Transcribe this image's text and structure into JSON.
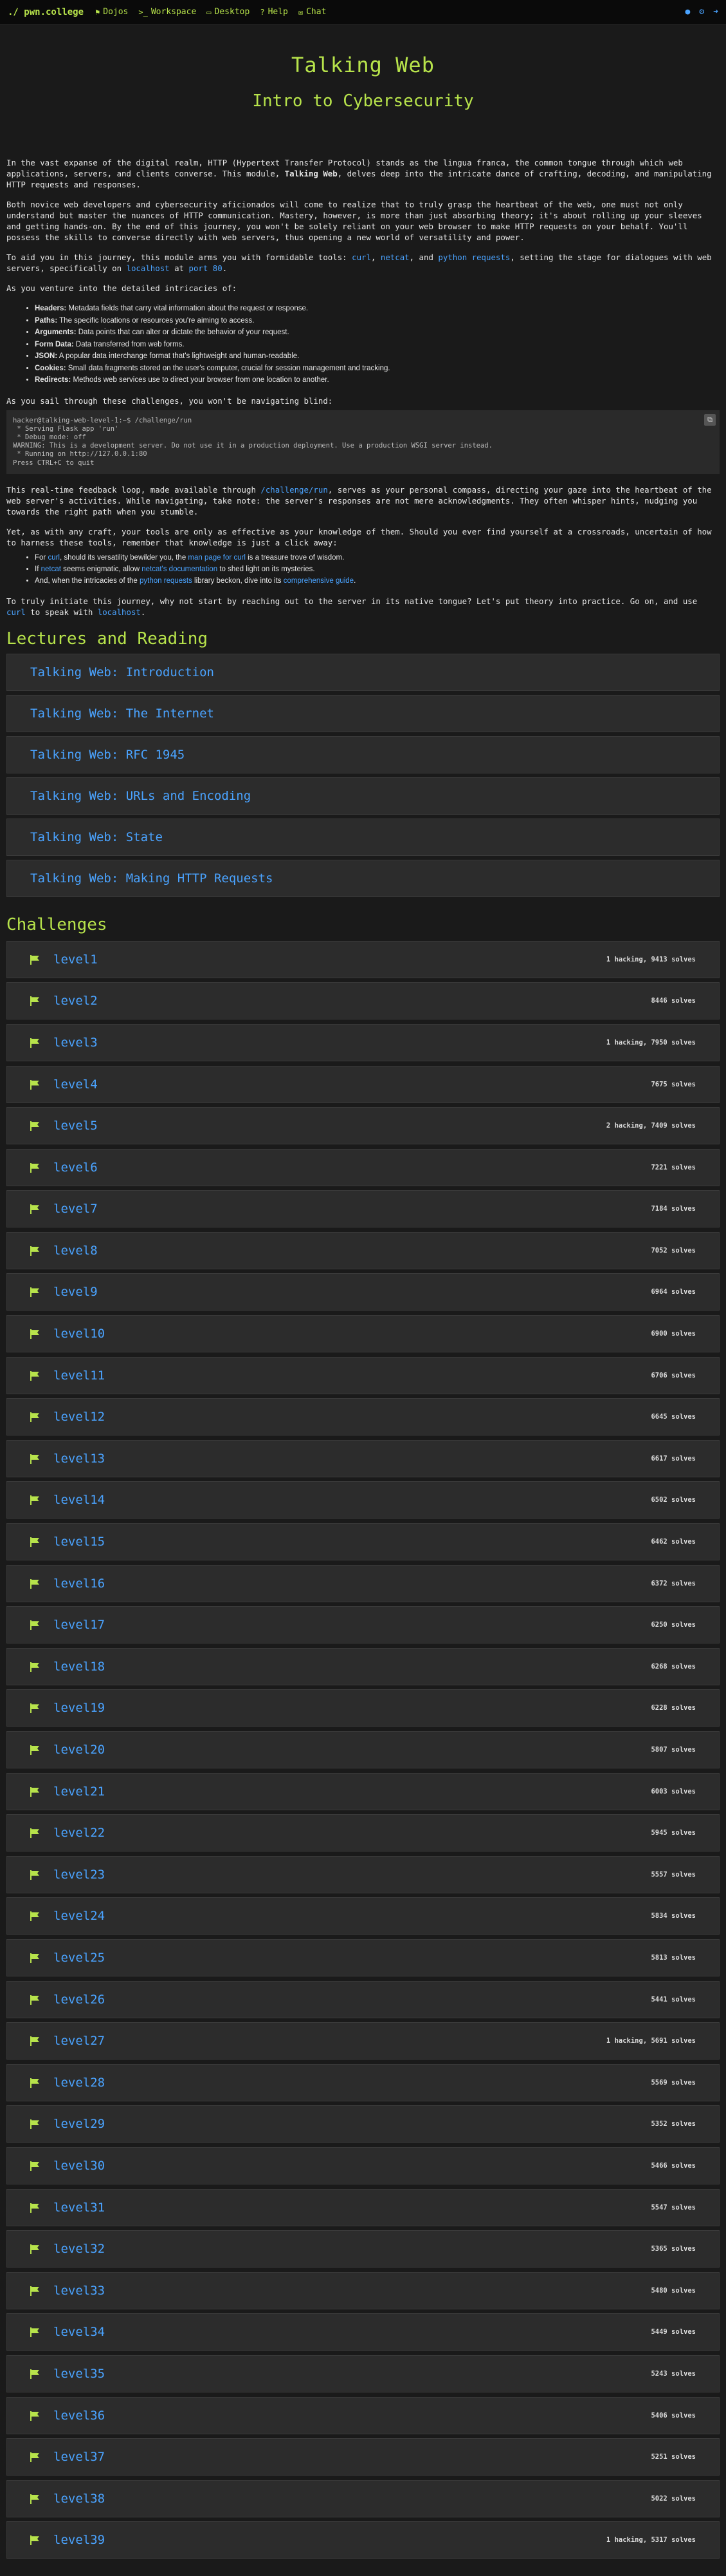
{
  "nav": {
    "brand": "./ pwn.college",
    "items": [
      {
        "label": "Dojos",
        "icon": "flag-icon"
      },
      {
        "label": "Workspace",
        "icon": "terminal-icon"
      },
      {
        "label": "Desktop",
        "icon": "desktop-icon"
      },
      {
        "label": "Help",
        "icon": "question-icon"
      },
      {
        "label": "Chat",
        "icon": "chat-icon"
      }
    ],
    "right_icons": [
      "user-circle-icon",
      "settings-icon",
      "logout-icon"
    ]
  },
  "hero": {
    "title": "Talking Web",
    "subtitle": "Intro to Cybersecurity"
  },
  "desc": {
    "p1": "In the vast expanse of the digital realm, HTTP (Hypertext Transfer Protocol) stands as the lingua franca, the common tongue through which web applications, servers, and clients converse. This module, ",
    "p1_bold": "Talking Web",
    "p1_end": ", delves deep into the intricate dance of crafting, decoding, and manipulating HTTP requests and responses.",
    "p2": "Both novice web developers and cybersecurity aficionados will come to realize that to truly grasp the heartbeat of the web, one must not only understand but master the nuances of HTTP communication. Mastery, however, is more than just absorbing theory; it's about rolling up your sleeves and getting hands-on. By the end of this journey, you won't be solely reliant on your web browser to make HTTP requests on your behalf. You'll possess the skills to converse directly with web servers, thus opening a new world of versatility and power.",
    "p3_a": "To aid you in this journey, this module arms you with formidable tools: ",
    "p3_curl": "curl",
    "p3_b": ", ",
    "p3_netcat": "netcat",
    "p3_c": ", and ",
    "p3_requests": "python requests",
    "p3_d": ", setting the stage for dialogues with web servers, specifically on ",
    "p3_localhost": "localhost",
    "p3_e": " at ",
    "p3_port": "port 80",
    "p3_f": ".",
    "p4": "As you venture into the detailed intricacies of:",
    "terms": [
      {
        "term": "Headers:",
        "def": " Metadata fields that carry vital information about the request or response."
      },
      {
        "term": "Paths:",
        "def": " The specific locations or resources you're aiming to access."
      },
      {
        "term": "Arguments:",
        "def": " Data points that can alter or dictate the behavior of your request."
      },
      {
        "term": "Form Data:",
        "def": " Data transferred from web forms."
      },
      {
        "term": "JSON:",
        "def": " A popular data interchange format that's lightweight and human-readable."
      },
      {
        "term": "Cookies:",
        "def": " Small data fragments stored on the user's computer, crucial for session management and tracking."
      },
      {
        "term": "Redirects:",
        "def": " Methods web services use to direct your browser from one location to another."
      }
    ],
    "p5": "As you sail through these challenges, you won't be navigating blind:",
    "code": "hacker@talking-web-level-1:~$ /challenge/run\n * Serving Flask app 'run'\n * Debug mode: off\nWARNING: This is a development server. Do not use it in a production deployment. Use a production WSGI server instead.\n * Running on http://127.0.0.1:80\nPress CTRL+C to quit",
    "p6_a": "This real-time feedback loop, made available through ",
    "p6_link": "/challenge/run",
    "p6_b": ", serves as your personal compass, directing your gaze into the heartbeat of the web server's activities. While navigating, take note: the server's responses are not mere acknowledgments. They often whisper hints, nudging you towards the right path when you stumble.",
    "p7": "Yet, as with any craft, your tools are only as effective as your knowledge of them. Should you ever find yourself at a crossroads, uncertain of how to harness these tools, remember that knowledge is just a click away:",
    "tip1_a": "For ",
    "tip1_curl": "curl",
    "tip1_b": ", should its versatility bewilder you, the ",
    "tip1_link": "man page for curl",
    "tip1_c": " is a treasure trove of wisdom.",
    "tip2_a": "If ",
    "tip2_netcat": "netcat",
    "tip2_b": " seems enigmatic, allow ",
    "tip2_link": "netcat's documentation",
    "tip2_c": " to shed light on its mysteries.",
    "tip3_a": "And, when the intricacies of the ",
    "tip3_req": "python requests",
    "tip3_b": " library beckon, dive into its ",
    "tip3_link": "comprehensive guide",
    "tip3_c": ".",
    "p8_a": "To truly initiate this journey, why not start by reaching out to the server in its native tongue? Let's put theory into practice. Go on, and use ",
    "p8_curl": "curl",
    "p8_b": " to speak with ",
    "p8_localhost": "localhost",
    "p8_c": "."
  },
  "lectures_title": "Lectures and Reading",
  "lectures": [
    "Talking Web: Introduction",
    "Talking Web: The Internet",
    "Talking Web: RFC 1945",
    "Talking Web: URLs and Encoding",
    "Talking Web: State",
    "Talking Web: Making HTTP Requests"
  ],
  "challenges_title": "Challenges",
  "challenges": [
    {
      "name": "level1",
      "stats": "1 hacking, 9413 solves"
    },
    {
      "name": "level2",
      "stats": "8446 solves"
    },
    {
      "name": "level3",
      "stats": "1 hacking, 7950 solves"
    },
    {
      "name": "level4",
      "stats": "7675 solves"
    },
    {
      "name": "level5",
      "stats": "2 hacking, 7409 solves"
    },
    {
      "name": "level6",
      "stats": "7221 solves"
    },
    {
      "name": "level7",
      "stats": "7184 solves"
    },
    {
      "name": "level8",
      "stats": "7052 solves"
    },
    {
      "name": "level9",
      "stats": "6964 solves"
    },
    {
      "name": "level10",
      "stats": "6900 solves"
    },
    {
      "name": "level11",
      "stats": "6706 solves"
    },
    {
      "name": "level12",
      "stats": "6645 solves"
    },
    {
      "name": "level13",
      "stats": "6617 solves"
    },
    {
      "name": "level14",
      "stats": "6502 solves"
    },
    {
      "name": "level15",
      "stats": "6462 solves"
    },
    {
      "name": "level16",
      "stats": "6372 solves"
    },
    {
      "name": "level17",
      "stats": "6250 solves"
    },
    {
      "name": "level18",
      "stats": "6268 solves"
    },
    {
      "name": "level19",
      "stats": "6228 solves"
    },
    {
      "name": "level20",
      "stats": "5807 solves"
    },
    {
      "name": "level21",
      "stats": "6003 solves"
    },
    {
      "name": "level22",
      "stats": "5945 solves"
    },
    {
      "name": "level23",
      "stats": "5557 solves"
    },
    {
      "name": "level24",
      "stats": "5834 solves"
    },
    {
      "name": "level25",
      "stats": "5813 solves"
    },
    {
      "name": "level26",
      "stats": "5441 solves"
    },
    {
      "name": "level27",
      "stats": "1 hacking, 5691 solves"
    },
    {
      "name": "level28",
      "stats": "5569 solves"
    },
    {
      "name": "level29",
      "stats": "5352 solves"
    },
    {
      "name": "level30",
      "stats": "5466 solves"
    },
    {
      "name": "level31",
      "stats": "5547 solves"
    },
    {
      "name": "level32",
      "stats": "5365 solves"
    },
    {
      "name": "level33",
      "stats": "5480 solves"
    },
    {
      "name": "level34",
      "stats": "5449 solves"
    },
    {
      "name": "level35",
      "stats": "5243 solves"
    },
    {
      "name": "level36",
      "stats": "5406 solves"
    },
    {
      "name": "level37",
      "stats": "5251 solves"
    },
    {
      "name": "level38",
      "stats": "5022 solves"
    },
    {
      "name": "level39",
      "stats": "1 hacking, 5317 solves"
    }
  ]
}
